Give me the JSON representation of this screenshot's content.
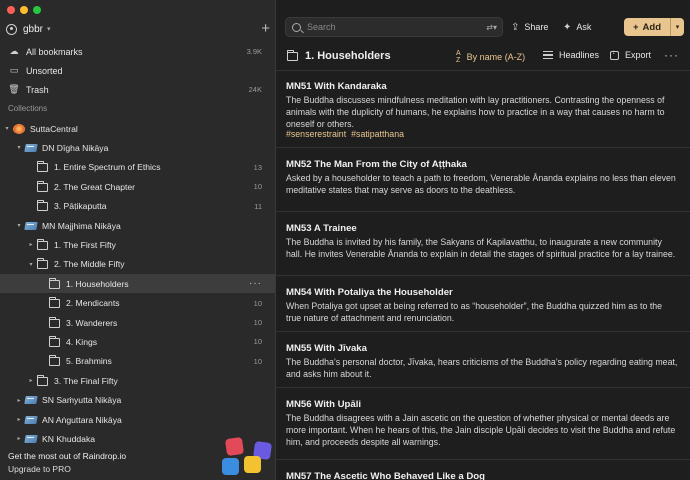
{
  "account": {
    "name": "gbbr"
  },
  "nav": [
    {
      "label": "All bookmarks",
      "count": "3.9K",
      "icon": "cloud-icon"
    },
    {
      "label": "Unsorted",
      "count": "",
      "icon": "inbox-icon"
    },
    {
      "label": "Trash",
      "count": "24K",
      "icon": "trash-icon"
    }
  ],
  "collections_label": "Collections",
  "tree": [
    {
      "label": "SuttaCentral",
      "count": "",
      "level": 0,
      "arrow": "▾",
      "icon": "sutta"
    },
    {
      "label": "DN Dīgha Nikāya",
      "count": "",
      "level": 1,
      "arrow": "▾",
      "icon": "book"
    },
    {
      "label": "1. Entire Spectrum of Ethics",
      "count": "13",
      "level": 2,
      "arrow": "",
      "icon": "folder"
    },
    {
      "label": "2. The Great Chapter",
      "count": "10",
      "level": 2,
      "arrow": "",
      "icon": "folder"
    },
    {
      "label": "3. Pāṭikaputta",
      "count": "11",
      "level": 2,
      "arrow": "",
      "icon": "folder"
    },
    {
      "label": "MN Majjhima Nikāya",
      "count": "",
      "level": 1,
      "arrow": "▾",
      "icon": "book"
    },
    {
      "label": "1. The First Fifty",
      "count": "",
      "level": 2,
      "arrow": "▸",
      "icon": "folder"
    },
    {
      "label": "2. The Middle Fifty",
      "count": "",
      "level": 2,
      "arrow": "▾",
      "icon": "folder"
    },
    {
      "label": "1. Householders",
      "count": "",
      "level": 3,
      "arrow": "",
      "icon": "folder",
      "selected": true
    },
    {
      "label": "2. Mendicants",
      "count": "10",
      "level": 3,
      "arrow": "",
      "icon": "folder"
    },
    {
      "label": "3. Wanderers",
      "count": "10",
      "level": 3,
      "arrow": "",
      "icon": "folder"
    },
    {
      "label": "4. Kings",
      "count": "10",
      "level": 3,
      "arrow": "",
      "icon": "folder"
    },
    {
      "label": "5. Brahmins",
      "count": "10",
      "level": 3,
      "arrow": "",
      "icon": "folder"
    },
    {
      "label": "3. The Final Fifty",
      "count": "",
      "level": 2,
      "arrow": "▸",
      "icon": "folder"
    },
    {
      "label": "SN Saṁyutta Nikāya",
      "count": "",
      "level": 1,
      "arrow": "▸",
      "icon": "book"
    },
    {
      "label": "AN Aṅguttara Nikāya",
      "count": "",
      "level": 1,
      "arrow": "▸",
      "icon": "book"
    },
    {
      "label": "KN Khuddaka",
      "count": "",
      "level": 1,
      "arrow": "▸",
      "icon": "book"
    }
  ],
  "promo": {
    "line1": "Get the most out of Raindrop.io",
    "line2": "Upgrade to PRO"
  },
  "toolbar": {
    "search_placeholder": "Search",
    "share": "Share",
    "ask": "Ask",
    "add": "Add"
  },
  "header": {
    "title": "1. Householders",
    "sort": "By name (A-Z)",
    "view": "Headlines",
    "export": "Export"
  },
  "items": [
    {
      "title": "MN51 With Kandaraka",
      "desc": "The Buddha discusses mindfulness meditation with lay practitioners. Contrasting the openness of animals with the duplicity of humans, he explains how to practice in a way that causes no harm to oneself or others.",
      "tags": [
        "#senserestraint",
        "#satipatthana"
      ]
    },
    {
      "title": "MN52 The Man From the City of Aṭṭhaka",
      "desc": "Asked by a householder to teach a path to freedom, Venerable Ānanda explains no less than eleven meditative states that may serve as doors to the deathless.",
      "tags": []
    },
    {
      "title": "MN53 A Trainee",
      "desc": "The Buddha is invited by his family, the Sakyans of Kapilavatthu, to inaugurate a new community hall. He invites Venerable Ānanda to explain in detail the stages of spiritual practice for a lay trainee.",
      "tags": []
    },
    {
      "title": "MN54 With Potaliya the Householder",
      "desc": "When Potaliya got upset at being referred to as “householder”, the Buddha quizzed him as to the true nature of attachment and renunciation.",
      "tags": []
    },
    {
      "title": "MN55 With Jīvaka",
      "desc": "The Buddha’s personal doctor, Jīvaka, hears criticisms of the Buddha’s policy regarding eating meat, and asks him about it.",
      "tags": []
    },
    {
      "title": "MN56 With Upāli",
      "desc": "The Buddha disagrees with a Jain ascetic on the question of whether physical or mental deeds are more important. When he hears of this, the Jain disciple Upāli decides to visit the Buddha and refute him, and proceeds despite all warnings.",
      "tags": []
    },
    {
      "title": "MN57 The Ascetic Who Behaved Like a Dog",
      "desc": "",
      "tags": []
    }
  ],
  "colors": {
    "accent": "#e8c58f",
    "sidebar_bg": "#2a2a2a",
    "main_bg": "#1e1e1e",
    "selected_bg": "#3d3d3d"
  }
}
